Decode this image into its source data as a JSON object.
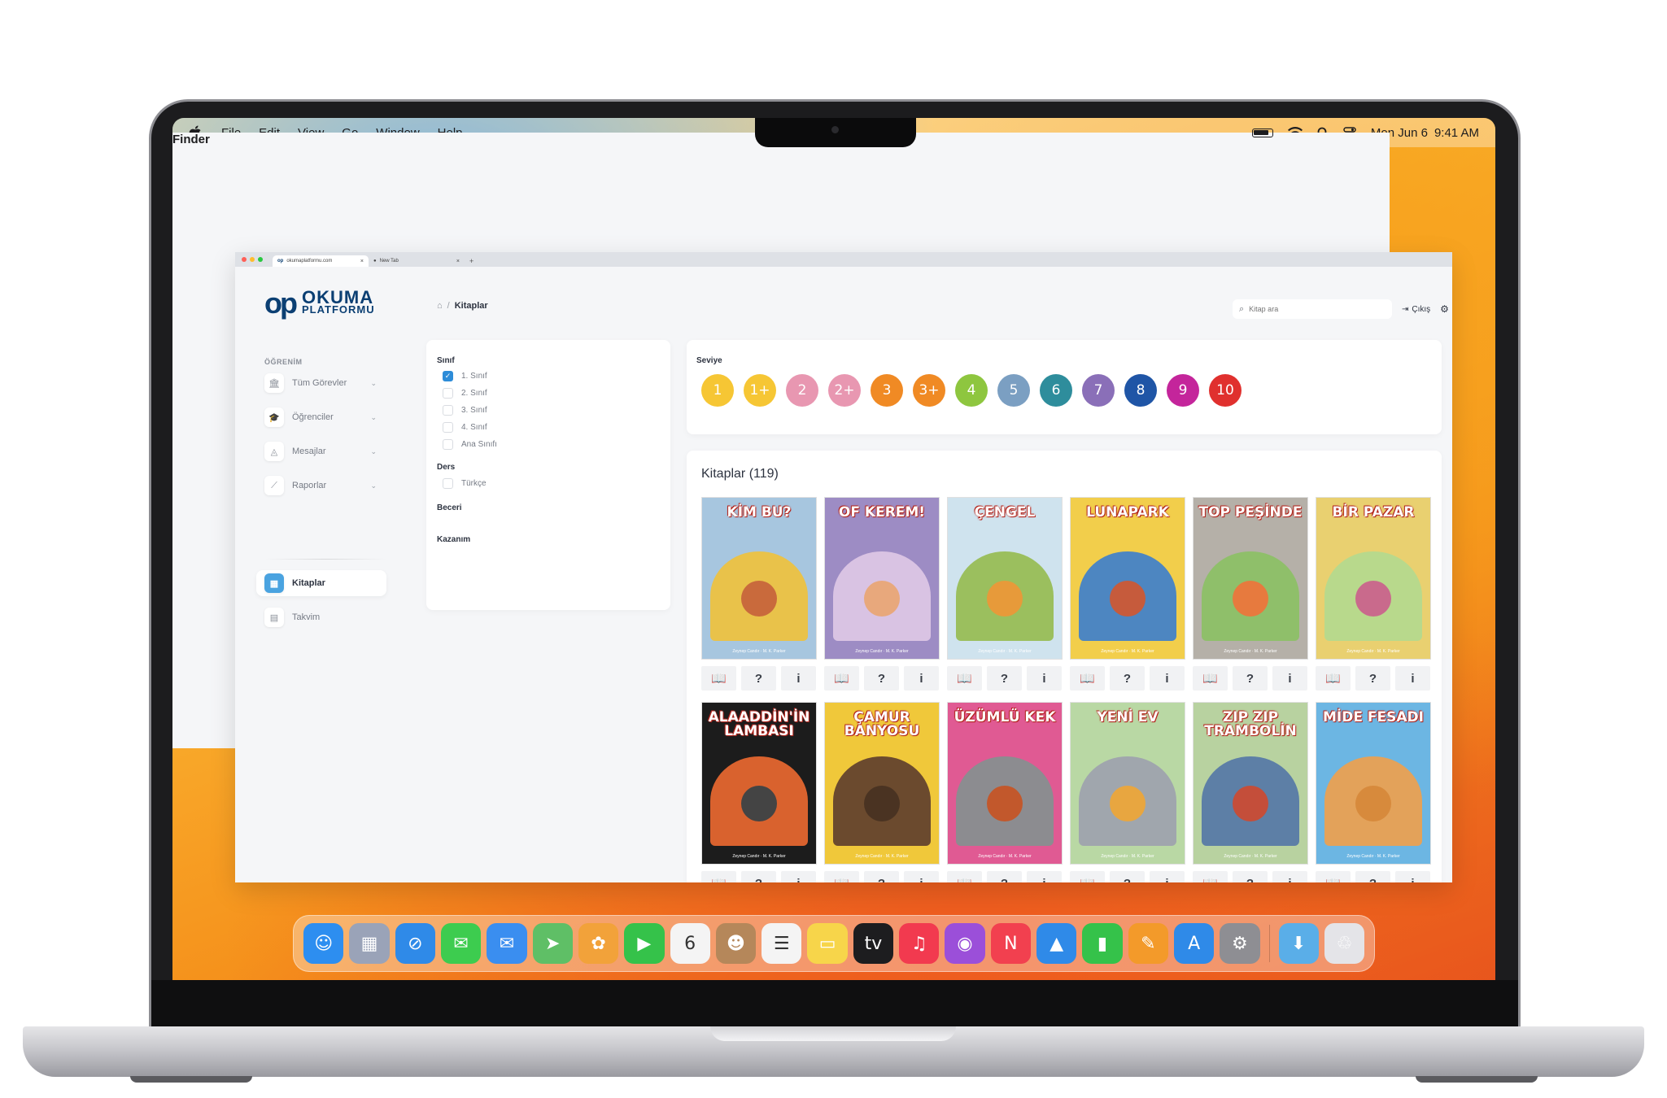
{
  "menubar": {
    "app_name": "Finder",
    "items": [
      "File",
      "Edit",
      "View",
      "Go",
      "Window",
      "Help"
    ],
    "date": "Mon Jun 6",
    "time": "9:41 AM"
  },
  "browser": {
    "tabs": [
      {
        "label": "okumaplatformu.com",
        "close": "×"
      },
      {
        "label": "New Tab",
        "close": "×"
      }
    ],
    "new_tab": "+"
  },
  "app": {
    "logo": {
      "mark": "op",
      "line1": "OKUMA",
      "line2": "PLATFORMU"
    },
    "sidebar": {
      "section_label": "ÖĞRENİM",
      "items": [
        {
          "label": "Tüm Görevler",
          "icon": "🏛",
          "chevron": "⌄"
        },
        {
          "label": "Öğrenciler",
          "icon": "🎓",
          "chevron": "⌄"
        },
        {
          "label": "Mesajlar",
          "icon": "◬",
          "chevron": "⌄"
        },
        {
          "label": "Raporlar",
          "icon": "⟋",
          "chevron": "⌄"
        }
      ],
      "secondary": [
        {
          "label": "Kitaplar",
          "icon": "▦"
        },
        {
          "label": "Takvim",
          "icon": "▤"
        }
      ]
    },
    "breadcrumb": {
      "home_icon": "⌂",
      "separator": "/",
      "current": "Kitaplar"
    },
    "search": {
      "icon": "⌕",
      "placeholder": "Kitap ara"
    },
    "logout_label": "Çıkış",
    "logout_icon": "⇥",
    "settings_icon": "⚙",
    "filters": {
      "sinif_title": "Sınıf",
      "sinif_options": [
        {
          "label": "1. Sınıf",
          "checked": true,
          "mark": "✓"
        },
        {
          "label": "2. Sınıf",
          "checked": false,
          "mark": ""
        },
        {
          "label": "3. Sınıf",
          "checked": false,
          "mark": ""
        },
        {
          "label": "4. Sınıf",
          "checked": false,
          "mark": ""
        },
        {
          "label": "Ana Sınıfı",
          "checked": false,
          "mark": ""
        }
      ],
      "ders_title": "Ders",
      "ders_options": [
        {
          "label": "Türkçe",
          "checked": false,
          "mark": ""
        }
      ],
      "beceri_title": "Beceri",
      "kazanim_title": "Kazanım"
    },
    "levels": {
      "title": "Seviye",
      "items": [
        {
          "label": "1",
          "color": "#f6c634"
        },
        {
          "label": "1+",
          "color": "#f6c634"
        },
        {
          "label": "2",
          "color": "#e897b1"
        },
        {
          "label": "2+",
          "color": "#e897b1"
        },
        {
          "label": "3",
          "color": "#f08a24"
        },
        {
          "label": "3+",
          "color": "#f08a24"
        },
        {
          "label": "4",
          "color": "#8ec63f"
        },
        {
          "label": "5",
          "color": "#7b9fc2"
        },
        {
          "label": "6",
          "color": "#2e8d9c"
        },
        {
          "label": "7",
          "color": "#8a6fb8"
        },
        {
          "label": "8",
          "color": "#1f55a6"
        },
        {
          "label": "9",
          "color": "#c4259b"
        },
        {
          "label": "10",
          "color": "#e0302e"
        }
      ]
    },
    "books": {
      "title": "Kitaplar (119)",
      "action_icons": [
        "📖",
        "?",
        "i"
      ],
      "authors": "Zeynep Candır · M. K. Parker",
      "items": [
        {
          "title": "KİM BU?",
          "bg": "#a7c6df",
          "scene": "#e9c24a",
          "figure": "#c96a3c"
        },
        {
          "title": "OF KEREM!",
          "bg": "#9d8cc4",
          "scene": "#d9c3e3",
          "figure": "#e8a87c"
        },
        {
          "title": "ÇENGEL",
          "bg": "#cfe3ee",
          "scene": "#9bbf5e",
          "figure": "#e79a3a"
        },
        {
          "title": "LUNAPARK",
          "bg": "#f2ce4b",
          "scene": "#4d86c1",
          "figure": "#c65b3c"
        },
        {
          "title": "TOP PEŞİNDE",
          "bg": "#b5b0a8",
          "scene": "#8fbf6a",
          "figure": "#e77a3e"
        },
        {
          "title": "BİR PAZAR",
          "bg": "#e9d070",
          "scene": "#b8d98c",
          "figure": "#c96a8c"
        },
        {
          "title": "ALAADDİN'İN LAMBASI",
          "bg": "#1c1c1c",
          "scene": "#d9622e",
          "figure": "#444444"
        },
        {
          "title": "ÇAMUR BANYOSU",
          "bg": "#f0c83a",
          "scene": "#6b4a2e",
          "figure": "#4a3322"
        },
        {
          "title": "ÜZÜMLÜ KEK",
          "bg": "#e05a93",
          "scene": "#8c8c90",
          "figure": "#c2582c"
        },
        {
          "title": "YENİ EV",
          "bg": "#b9d8a4",
          "scene": "#a0a6ad",
          "figure": "#e8a640"
        },
        {
          "title": "ZIP ZIP TRAMBOLİN",
          "bg": "#b8d2a0",
          "scene": "#5d7fa6",
          "figure": "#c44e3a"
        },
        {
          "title": "MİDE FESADI",
          "bg": "#6cb6e3",
          "scene": "#e3a25a",
          "figure": "#d78a3c"
        }
      ]
    }
  },
  "dock": {
    "apps": [
      {
        "name": "finder",
        "glyph": "☺",
        "color": "#2d8ef0"
      },
      {
        "name": "launchpad",
        "glyph": "▦",
        "color": "#9aa3b8"
      },
      {
        "name": "safari",
        "glyph": "⊘",
        "color": "#2f8ae8"
      },
      {
        "name": "messages",
        "glyph": "✉",
        "color": "#3dcc4f"
      },
      {
        "name": "mail",
        "glyph": "✉",
        "color": "#3a8ef0"
      },
      {
        "name": "maps",
        "glyph": "➤",
        "color": "#5fbf66"
      },
      {
        "name": "photos",
        "glyph": "✿",
        "color": "#f2a23a"
      },
      {
        "name": "facetime",
        "glyph": "▶",
        "color": "#35c24a"
      },
      {
        "name": "calendar",
        "glyph": "6",
        "color": "#f4f4f4"
      },
      {
        "name": "contacts",
        "glyph": "☻",
        "color": "#b5875a"
      },
      {
        "name": "reminders",
        "glyph": "☰",
        "color": "#f4f4f4"
      },
      {
        "name": "notes",
        "glyph": "▭",
        "color": "#f7d54a"
      },
      {
        "name": "tv",
        "glyph": "tv",
        "color": "#1d1d1f"
      },
      {
        "name": "music",
        "glyph": "♫",
        "color": "#f23a4f"
      },
      {
        "name": "podcasts",
        "glyph": "◉",
        "color": "#9b4fd9"
      },
      {
        "name": "news",
        "glyph": "N",
        "color": "#f2404f"
      },
      {
        "name": "keynote",
        "glyph": "▲",
        "color": "#2f8ae8"
      },
      {
        "name": "numbers",
        "glyph": "▮",
        "color": "#35c24a"
      },
      {
        "name": "pages",
        "glyph": "✎",
        "color": "#f39a2a"
      },
      {
        "name": "app-store",
        "glyph": "A",
        "color": "#2f8ae8"
      },
      {
        "name": "system-settings",
        "glyph": "⚙",
        "color": "#8e8e93"
      }
    ],
    "extras": [
      {
        "name": "downloads-folder",
        "glyph": "⬇",
        "color": "#5aaee8"
      },
      {
        "name": "trash",
        "glyph": "♲",
        "color": "#e4e4e8"
      }
    ]
  }
}
